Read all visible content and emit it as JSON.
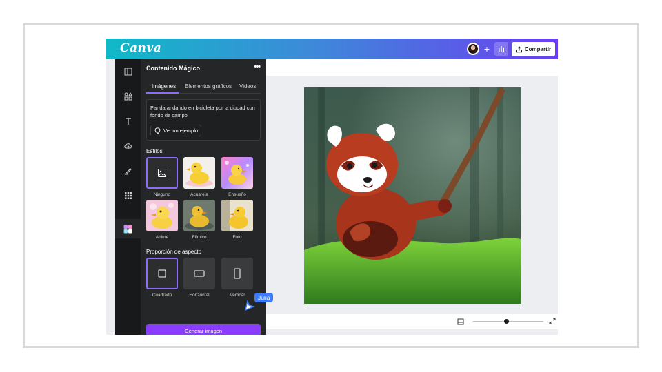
{
  "app": {
    "logo_text": "Canva",
    "share_label": "Compartir",
    "accent_color": "#8b3dff"
  },
  "panel": {
    "title": "Contenido Mágico",
    "more_label": "•••",
    "tabs": [
      {
        "label": "Imágenes",
        "active": true
      },
      {
        "label": "Elementos gráficos",
        "active": false
      },
      {
        "label": "Videos",
        "active": false
      }
    ],
    "prompt_text": "Panda andando en bicicleta por la ciudad con fondo de campo",
    "example_label": "Ver un ejemplo",
    "styles_label": "Estilos",
    "styles": [
      {
        "label": "Ninguno",
        "selected": true
      },
      {
        "label": "Acuarela",
        "selected": false
      },
      {
        "label": "Ensueño",
        "selected": false
      },
      {
        "label": "Anime",
        "selected": false
      },
      {
        "label": "Fílmico",
        "selected": false
      },
      {
        "label": "Foto",
        "selected": false
      }
    ],
    "aspect_label": "Proporción de aspecto",
    "aspects": [
      {
        "label": "Cuadrado",
        "selected": true
      },
      {
        "label": "Horizontal",
        "selected": false
      },
      {
        "label": "Vertical",
        "selected": false
      }
    ],
    "generate_label": "Generar imagen"
  },
  "collaborator": {
    "name": "Julia"
  },
  "rail_icons": [
    "templates-icon",
    "elements-icon",
    "text-icon",
    "uploads-icon",
    "draw-icon",
    "apps-icon",
    "magic-media-icon"
  ]
}
